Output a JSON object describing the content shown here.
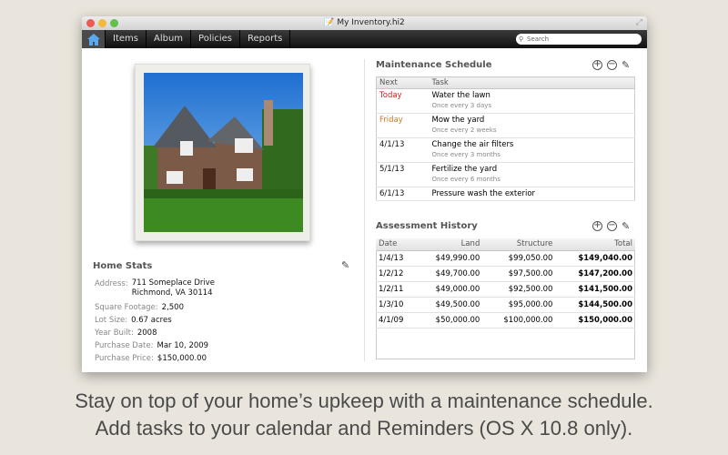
{
  "window": {
    "title": "My Inventory.hi2"
  },
  "toolbar": {
    "tabs": [
      "Items",
      "Album",
      "Policies",
      "Reports"
    ],
    "search_placeholder": "Search"
  },
  "home_stats": {
    "title": "Home Stats",
    "rows": [
      {
        "label": "Address:",
        "value": "711 Someplace Drive",
        "value2": "Richmond, VA 30114"
      },
      {
        "label": "Square Footage:",
        "value": "2,500"
      },
      {
        "label": "Lot Size:",
        "value": "0.67 acres"
      },
      {
        "label": "Year Built:",
        "value": "2008"
      },
      {
        "label": "Purchase Date:",
        "value": "Mar 10, 2009"
      },
      {
        "label": "Purchase Price:",
        "value": "$150,000.00"
      }
    ]
  },
  "maintenance": {
    "title": "Maintenance Schedule",
    "columns": [
      "Next",
      "Task"
    ],
    "rows": [
      {
        "next": "Today",
        "task": "Water the lawn",
        "freq": "Once every 3 days",
        "color": "#cc1f1f"
      },
      {
        "next": "Friday",
        "task": "Mow the yard",
        "freq": "Once every 2 weeks",
        "color": "#d07a1c"
      },
      {
        "next": "4/1/13",
        "task": "Change the air filters",
        "freq": "Once every 3 months",
        "color": "#111111"
      },
      {
        "next": "5/1/13",
        "task": "Fertilize the yard",
        "freq": "Once every 6 months",
        "color": "#111111"
      },
      {
        "next": "6/1/13",
        "task": "Pressure wash the exterior",
        "freq": "",
        "color": "#111111"
      }
    ]
  },
  "assessment": {
    "title": "Assessment History",
    "columns": [
      "Date",
      "Land",
      "Structure",
      "Total"
    ],
    "rows": [
      [
        "1/4/13",
        "$49,990.00",
        "$99,050.00",
        "$149,040.00"
      ],
      [
        "1/2/12",
        "$49,700.00",
        "$97,500.00",
        "$147,200.00"
      ],
      [
        "1/2/11",
        "$49,000.00",
        "$92,500.00",
        "$141,500.00"
      ],
      [
        "1/3/10",
        "$49,500.00",
        "$95,000.00",
        "$144,500.00"
      ],
      [
        "4/1/09",
        "$50,000.00",
        "$100,000.00",
        "$150,000.00"
      ]
    ]
  },
  "caption": [
    "Stay on top of your home’s upkeep with a maintenance schedule.",
    "Add tasks to your calendar and Reminders (OS X 10.8 only)."
  ]
}
